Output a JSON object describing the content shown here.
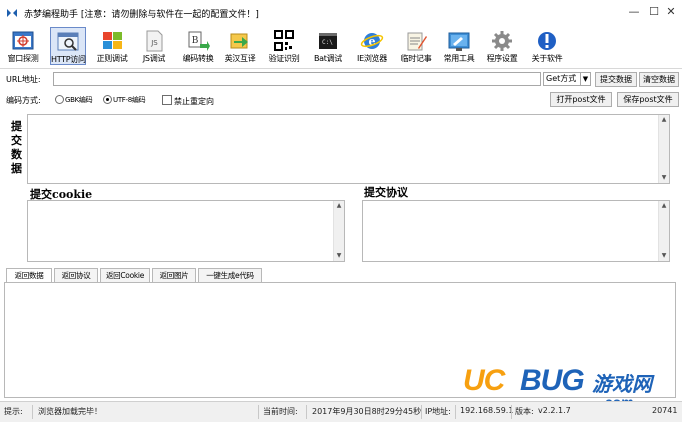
{
  "window": {
    "title": "赤梦编程助手  [注意：请勿删除与软件在一起的配置文件！]",
    "controls": {
      "minimize": "—",
      "maximize": "☐",
      "close": "✕"
    }
  },
  "toolbar": [
    {
      "label": "窗口探测",
      "icon": "window-probe-icon"
    },
    {
      "label": "HTTP访问",
      "icon": "http-access-icon",
      "active": true
    },
    {
      "label": "正则调试",
      "icon": "regex-icon"
    },
    {
      "label": "JS调试",
      "icon": "js-icon"
    },
    {
      "label": "编码转换",
      "icon": "encode-convert-icon"
    },
    {
      "label": "英汉互译",
      "icon": "translate-icon"
    },
    {
      "label": "验证识别",
      "icon": "qr-code-icon"
    },
    {
      "label": "Bat调试",
      "icon": "bat-console-icon"
    },
    {
      "label": "IE浏览器",
      "icon": "ie-browser-icon"
    },
    {
      "label": "临时记事",
      "icon": "notepad-icon"
    },
    {
      "label": "常用工具",
      "icon": "tools-icon"
    },
    {
      "label": "程序设置",
      "icon": "settings-gear-icon"
    },
    {
      "label": "关于软件",
      "icon": "info-icon"
    }
  ],
  "url_row": {
    "label": "URL地址:",
    "url_value": "",
    "method": "Get方式",
    "submit_button": "提交数据",
    "clear_button": "清空数据"
  },
  "encoding_row": {
    "label": "编码方式:",
    "options": [
      {
        "label": "GBK编码",
        "selected": false
      },
      {
        "label": "UTF-8编码",
        "selected": true
      }
    ],
    "no_redirect_label": "禁止重定向",
    "no_redirect_checked": false,
    "open_post_button": "打开post文件",
    "save_post_button": "保存post文件"
  },
  "sections": {
    "post_data_label": "提交数据",
    "cookie_label": "提交cookie",
    "protocol_label": "提交协议"
  },
  "tabs": [
    {
      "label": "返回数据",
      "active": true
    },
    {
      "label": "返回协议",
      "active": false
    },
    {
      "label": "返回Cookie",
      "active": false
    },
    {
      "label": "返回图片",
      "active": false
    },
    {
      "label": "一键生成e代码",
      "active": false
    }
  ],
  "watermark": {
    "uc": "UC",
    "bug": "BUG",
    "cn": "游戏网",
    "com": ".com"
  },
  "statusbar": {
    "hint_label": "提示:",
    "hint_value": "浏览器加载完毕！",
    "time_label": "当前时间:",
    "time_value": "2017年9月30日8时29分45秒",
    "ip_label": "IP地址:",
    "ip_value": "192.168.59.1",
    "version_label": "版本:",
    "version_value": "v2.2.1.7",
    "extra_value": "20741"
  },
  "colors": {
    "accent": "#6a8ac9",
    "watermark_orange": "#f7a010",
    "watermark_blue": "#1e63b8"
  }
}
